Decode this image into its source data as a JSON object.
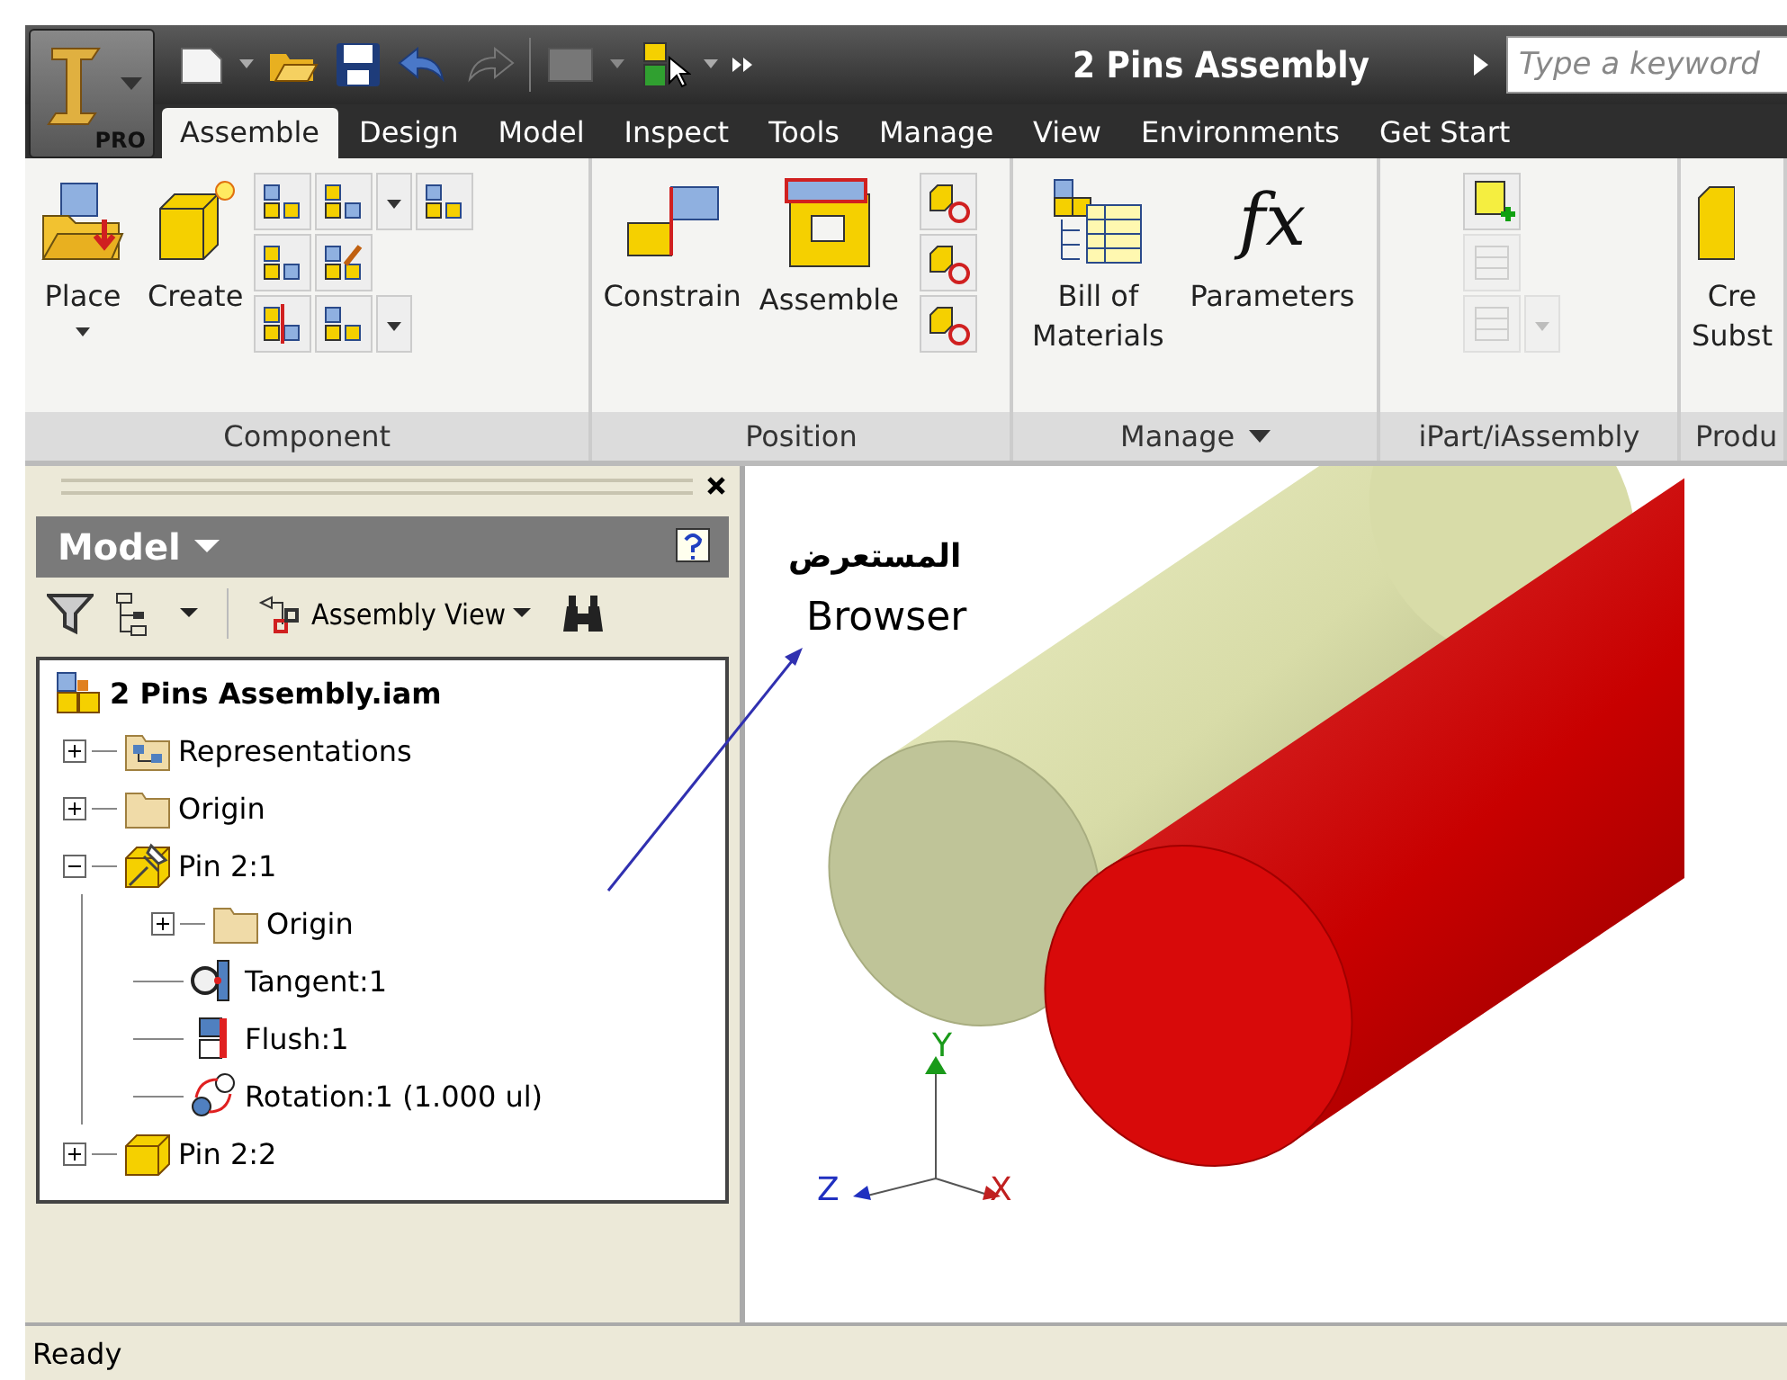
{
  "app_button": {
    "badge": "PRO"
  },
  "window": {
    "title": "2 Pins Assembly"
  },
  "search": {
    "placeholder": "Type a keyword"
  },
  "tabs": [
    {
      "label": "Assemble",
      "selected": true
    },
    {
      "label": "Design",
      "selected": false
    },
    {
      "label": "Model",
      "selected": false
    },
    {
      "label": "Inspect",
      "selected": false
    },
    {
      "label": "Tools",
      "selected": false
    },
    {
      "label": "Manage",
      "selected": false
    },
    {
      "label": "View",
      "selected": false
    },
    {
      "label": "Environments",
      "selected": false
    },
    {
      "label": "Get Start",
      "selected": false
    }
  ],
  "ribbon": [
    {
      "kind": "component",
      "label": "Component",
      "menu": false,
      "buttons": [
        {
          "label": "Place",
          "kind": "place",
          "dropdown": true
        },
        {
          "label": "Create",
          "kind": "create",
          "dropdown": false
        }
      ]
    },
    {
      "kind": "position",
      "label": "Position",
      "menu": false,
      "buttons": [
        {
          "label": "Constrain",
          "kind": "constrain",
          "dropdown": false
        },
        {
          "label": "Assemble",
          "kind": "assemble",
          "dropdown": false
        }
      ]
    },
    {
      "kind": "manage",
      "label": "Manage",
      "menu": true,
      "buttons": [
        {
          "label": "Bill of Materials",
          "kind": "bom",
          "dropdown": false
        },
        {
          "label": "Parameters",
          "kind": "parameters",
          "glyph": "fx",
          "dropdown": false
        }
      ]
    },
    {
      "kind": "ipart",
      "label": "iPart/iAssembly",
      "menu": false
    },
    {
      "kind": "product",
      "label": "Produ",
      "menu": false,
      "buttons": [
        {
          "label": "Cre Subst",
          "kind": "substitute",
          "dropdown": false
        }
      ]
    }
  ],
  "browser": {
    "title": "Model",
    "view": "Assembly View",
    "tree": {
      "label": "2 Pins Assembly.iam",
      "kind": "assembly",
      "children": [
        {
          "label": "Representations",
          "kind": "representations",
          "expanded": false
        },
        {
          "label": "Origin",
          "kind": "folder",
          "expanded": false
        },
        {
          "label": "Pin 2:1",
          "kind": "pinned-part",
          "expanded": true,
          "children": [
            {
              "label": "Origin",
              "kind": "folder",
              "expanded": false
            },
            {
              "label": "Tangent:1",
              "kind": "tangent"
            },
            {
              "label": "Flush:1",
              "kind": "flush"
            },
            {
              "label": "Rotation:1 (1.000 ul)",
              "kind": "rotation"
            }
          ]
        },
        {
          "label": "Pin 2:2",
          "kind": "part",
          "expanded": false
        }
      ]
    }
  },
  "annotation": {
    "caption": "المستعرض",
    "label": "Browser"
  },
  "axes": [
    {
      "label": "Y",
      "color": "#1a9a1a"
    },
    {
      "label": "Z",
      "color": "#2030c0"
    },
    {
      "label": "X",
      "color": "#c02020"
    }
  ],
  "status_bar": {
    "text": "Ready"
  }
}
